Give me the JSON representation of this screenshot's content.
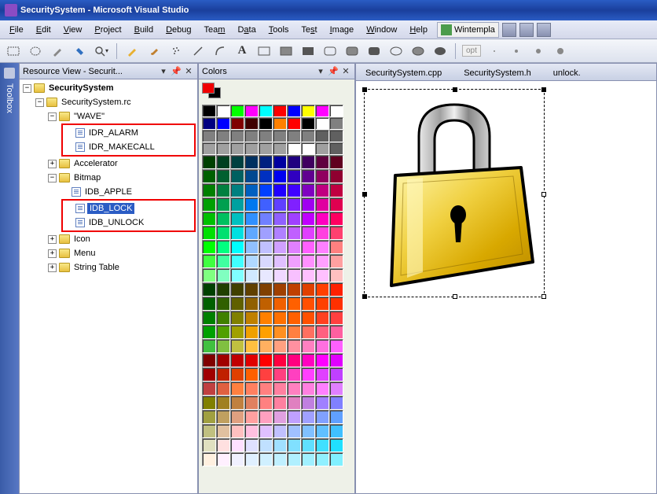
{
  "title": "SecuritySystem - Microsoft Visual Studio",
  "menu": {
    "file": "File",
    "edit": "Edit",
    "view": "View",
    "project": "Project",
    "build": "Build",
    "debug": "Debug",
    "team": "Team",
    "data": "Data",
    "tools": "Tools",
    "test": "Test",
    "image": "Image",
    "window": "Window",
    "help": "Help",
    "wintempla": "Wintempla"
  },
  "toolbar_opt": "opt",
  "panels": {
    "resource_title": "Resource View - Securit...",
    "colors_title": "Colors"
  },
  "tree": {
    "root": "SecuritySystem",
    "rc": "SecuritySystem.rc",
    "wave": "\"WAVE\"",
    "idr_alarm": "IDR_ALARM",
    "idr_makecall": "IDR_MAKECALL",
    "accelerator": "Accelerator",
    "bitmap": "Bitmap",
    "idb_apple": "IDB_APPLE",
    "idb_lock": "IDB_LOCK",
    "idb_unlock": "IDB_UNLOCK",
    "icon": "Icon",
    "menu": "Menu",
    "string_table": "String Table"
  },
  "editor_tabs": {
    "cpp": "SecuritySystem.cpp",
    "h": "SecuritySystem.h",
    "unlock": "unlock."
  },
  "sidebar_tab": "Toolbox",
  "color_rows": [
    [
      "#000000",
      "#ffffff",
      "#00ff00",
      "#ff00ff",
      "#00ffff",
      "#ff0000",
      "#0000ff",
      "#ffff00",
      "#ff00ff",
      "#ffffff"
    ],
    [
      "#000080",
      "#0000ff",
      "#800000",
      "#400000",
      "#000000",
      "#ff8000",
      "#ff0000",
      "#000000",
      "#ffffff",
      "#808080"
    ],
    [
      "#808080",
      "#808080",
      "#808080",
      "#808080",
      "#808080",
      "#808080",
      "#808080",
      "#808080",
      "#606060",
      "#606060"
    ],
    [
      "#a0a0a0",
      "#a0a0a0",
      "#a0a0a0",
      "#a0a0a0",
      "#a0a0a0",
      "#a0a0a0",
      "#ffffff",
      "#ffffff",
      "#a0a0a0",
      "#606060"
    ],
    [
      "#004000",
      "#004020",
      "#004040",
      "#003060",
      "#002080",
      "#0000a0",
      "#200080",
      "#400060",
      "#600040",
      "#600020"
    ],
    [
      "#006000",
      "#006030",
      "#006060",
      "#004890",
      "#0030c0",
      "#0000f0",
      "#3000c0",
      "#600090",
      "#900060",
      "#900030"
    ],
    [
      "#008000",
      "#008040",
      "#008080",
      "#0060c0",
      "#0040ff",
      "#2000ff",
      "#4000ff",
      "#8000c0",
      "#c00080",
      "#c00040"
    ],
    [
      "#00a000",
      "#00a050",
      "#00a0a0",
      "#0078f0",
      "#4060ff",
      "#6040ff",
      "#8020ff",
      "#a000f0",
      "#e000a0",
      "#e00050"
    ],
    [
      "#00c000",
      "#00c060",
      "#00c0c0",
      "#3090ff",
      "#7080ff",
      "#9060ff",
      "#a040ff",
      "#c000ff",
      "#ff00c0",
      "#ff0060"
    ],
    [
      "#00e000",
      "#00e070",
      "#00e0e0",
      "#60a8ff",
      "#a0a0ff",
      "#b080ff",
      "#c060ff",
      "#e040ff",
      "#ff40e0",
      "#ff4070"
    ],
    [
      "#00ff00",
      "#00ff80",
      "#00ffff",
      "#90c0ff",
      "#c0c0ff",
      "#d0a0ff",
      "#e080ff",
      "#ff60ff",
      "#ff80ff",
      "#ff8080"
    ],
    [
      "#40ff40",
      "#40ffa0",
      "#40ffff",
      "#b0d8ff",
      "#d8d8ff",
      "#e0c0ff",
      "#f0a0ff",
      "#ff90ff",
      "#ffa0ff",
      "#ffa0a0"
    ],
    [
      "#80ff80",
      "#80ffc0",
      "#80ffff",
      "#d0e8ff",
      "#e8e8ff",
      "#f0d8ff",
      "#f8c0ff",
      "#ffc0ff",
      "#ffc0ff",
      "#ffc0c0"
    ],
    [
      "#004000",
      "#204000",
      "#404000",
      "#604000",
      "#804000",
      "#a04000",
      "#c04000",
      "#e04000",
      "#ff4000",
      "#ff2000"
    ],
    [
      "#006000",
      "#306000",
      "#606000",
      "#906000",
      "#c06000",
      "#f06000",
      "#ff6000",
      "#ff5000",
      "#ff4000",
      "#ff3000"
    ],
    [
      "#008000",
      "#408000",
      "#808000",
      "#c08000",
      "#ff8000",
      "#ff7000",
      "#ff6000",
      "#ff5000",
      "#ff4020",
      "#ff4040"
    ],
    [
      "#00a000",
      "#50a000",
      "#a0a000",
      "#f0a000",
      "#ffa000",
      "#ff9020",
      "#ff8040",
      "#ff7060",
      "#ff6080",
      "#ff60a0"
    ],
    [
      "#40c040",
      "#80c040",
      "#c0c040",
      "#ffc040",
      "#ffb060",
      "#ffa080",
      "#ff90a0",
      "#ff80c0",
      "#ff70e0",
      "#ff60ff"
    ],
    [
      "#800000",
      "#a00000",
      "#c00000",
      "#e00000",
      "#ff0000",
      "#ff0040",
      "#ff0080",
      "#ff00c0",
      "#ff00ff",
      "#e000ff"
    ],
    [
      "#a00000",
      "#c02000",
      "#e04000",
      "#ff6000",
      "#ff4040",
      "#ff4080",
      "#ff40c0",
      "#ff40ff",
      "#e040ff",
      "#c040ff"
    ],
    [
      "#c04040",
      "#e06040",
      "#ff8040",
      "#ff8060",
      "#ff8080",
      "#ff80a0",
      "#ff80c0",
      "#ff80e0",
      "#ff80ff",
      "#e080ff"
    ],
    [
      "#808000",
      "#a08020",
      "#c08040",
      "#e08060",
      "#ff8080",
      "#ff80a0",
      "#e080c0",
      "#c080e0",
      "#a080ff",
      "#8080ff"
    ],
    [
      "#a0a040",
      "#c0a060",
      "#e0a080",
      "#ffa0a0",
      "#ffa0c0",
      "#e0a0e0",
      "#c0a0ff",
      "#a0a0ff",
      "#80a0ff",
      "#60a0ff"
    ],
    [
      "#c0c080",
      "#e0c0a0",
      "#ffc0c0",
      "#ffc0e0",
      "#e0c0ff",
      "#c0c0ff",
      "#a0c0ff",
      "#80c0ff",
      "#60c0ff",
      "#40c0ff"
    ],
    [
      "#e0e0c0",
      "#ffe0e0",
      "#ffe0ff",
      "#e0e0ff",
      "#c0e0ff",
      "#a0e0ff",
      "#80e0ff",
      "#60e0ff",
      "#40e0ff",
      "#20e0ff"
    ],
    [
      "#fff0e0",
      "#fff0ff",
      "#f0f0ff",
      "#e0f0ff",
      "#d0f0ff",
      "#c0f0ff",
      "#b0f0ff",
      "#a0f0ff",
      "#90f0ff",
      "#80f0ff"
    ]
  ]
}
